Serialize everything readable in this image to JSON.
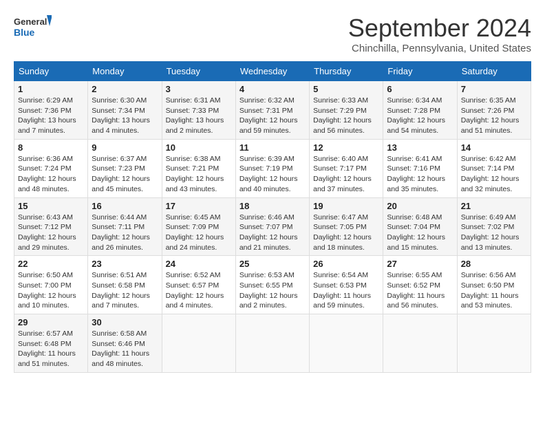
{
  "header": {
    "logo_line1": "General",
    "logo_line2": "Blue",
    "month": "September 2024",
    "location": "Chinchilla, Pennsylvania, United States"
  },
  "weekdays": [
    "Sunday",
    "Monday",
    "Tuesday",
    "Wednesday",
    "Thursday",
    "Friday",
    "Saturday"
  ],
  "weeks": [
    [
      {
        "day": "1",
        "info": "Sunrise: 6:29 AM\nSunset: 7:36 PM\nDaylight: 13 hours\nand 7 minutes."
      },
      {
        "day": "2",
        "info": "Sunrise: 6:30 AM\nSunset: 7:34 PM\nDaylight: 13 hours\nand 4 minutes."
      },
      {
        "day": "3",
        "info": "Sunrise: 6:31 AM\nSunset: 7:33 PM\nDaylight: 13 hours\nand 2 minutes."
      },
      {
        "day": "4",
        "info": "Sunrise: 6:32 AM\nSunset: 7:31 PM\nDaylight: 12 hours\nand 59 minutes."
      },
      {
        "day": "5",
        "info": "Sunrise: 6:33 AM\nSunset: 7:29 PM\nDaylight: 12 hours\nand 56 minutes."
      },
      {
        "day": "6",
        "info": "Sunrise: 6:34 AM\nSunset: 7:28 PM\nDaylight: 12 hours\nand 54 minutes."
      },
      {
        "day": "7",
        "info": "Sunrise: 6:35 AM\nSunset: 7:26 PM\nDaylight: 12 hours\nand 51 minutes."
      }
    ],
    [
      {
        "day": "8",
        "info": "Sunrise: 6:36 AM\nSunset: 7:24 PM\nDaylight: 12 hours\nand 48 minutes."
      },
      {
        "day": "9",
        "info": "Sunrise: 6:37 AM\nSunset: 7:23 PM\nDaylight: 12 hours\nand 45 minutes."
      },
      {
        "day": "10",
        "info": "Sunrise: 6:38 AM\nSunset: 7:21 PM\nDaylight: 12 hours\nand 43 minutes."
      },
      {
        "day": "11",
        "info": "Sunrise: 6:39 AM\nSunset: 7:19 PM\nDaylight: 12 hours\nand 40 minutes."
      },
      {
        "day": "12",
        "info": "Sunrise: 6:40 AM\nSunset: 7:17 PM\nDaylight: 12 hours\nand 37 minutes."
      },
      {
        "day": "13",
        "info": "Sunrise: 6:41 AM\nSunset: 7:16 PM\nDaylight: 12 hours\nand 35 minutes."
      },
      {
        "day": "14",
        "info": "Sunrise: 6:42 AM\nSunset: 7:14 PM\nDaylight: 12 hours\nand 32 minutes."
      }
    ],
    [
      {
        "day": "15",
        "info": "Sunrise: 6:43 AM\nSunset: 7:12 PM\nDaylight: 12 hours\nand 29 minutes."
      },
      {
        "day": "16",
        "info": "Sunrise: 6:44 AM\nSunset: 7:11 PM\nDaylight: 12 hours\nand 26 minutes."
      },
      {
        "day": "17",
        "info": "Sunrise: 6:45 AM\nSunset: 7:09 PM\nDaylight: 12 hours\nand 24 minutes."
      },
      {
        "day": "18",
        "info": "Sunrise: 6:46 AM\nSunset: 7:07 PM\nDaylight: 12 hours\nand 21 minutes."
      },
      {
        "day": "19",
        "info": "Sunrise: 6:47 AM\nSunset: 7:05 PM\nDaylight: 12 hours\nand 18 minutes."
      },
      {
        "day": "20",
        "info": "Sunrise: 6:48 AM\nSunset: 7:04 PM\nDaylight: 12 hours\nand 15 minutes."
      },
      {
        "day": "21",
        "info": "Sunrise: 6:49 AM\nSunset: 7:02 PM\nDaylight: 12 hours\nand 13 minutes."
      }
    ],
    [
      {
        "day": "22",
        "info": "Sunrise: 6:50 AM\nSunset: 7:00 PM\nDaylight: 12 hours\nand 10 minutes."
      },
      {
        "day": "23",
        "info": "Sunrise: 6:51 AM\nSunset: 6:58 PM\nDaylight: 12 hours\nand 7 minutes."
      },
      {
        "day": "24",
        "info": "Sunrise: 6:52 AM\nSunset: 6:57 PM\nDaylight: 12 hours\nand 4 minutes."
      },
      {
        "day": "25",
        "info": "Sunrise: 6:53 AM\nSunset: 6:55 PM\nDaylight: 12 hours\nand 2 minutes."
      },
      {
        "day": "26",
        "info": "Sunrise: 6:54 AM\nSunset: 6:53 PM\nDaylight: 11 hours\nand 59 minutes."
      },
      {
        "day": "27",
        "info": "Sunrise: 6:55 AM\nSunset: 6:52 PM\nDaylight: 11 hours\nand 56 minutes."
      },
      {
        "day": "28",
        "info": "Sunrise: 6:56 AM\nSunset: 6:50 PM\nDaylight: 11 hours\nand 53 minutes."
      }
    ],
    [
      {
        "day": "29",
        "info": "Sunrise: 6:57 AM\nSunset: 6:48 PM\nDaylight: 11 hours\nand 51 minutes."
      },
      {
        "day": "30",
        "info": "Sunrise: 6:58 AM\nSunset: 6:46 PM\nDaylight: 11 hours\nand 48 minutes."
      },
      {
        "day": "",
        "info": ""
      },
      {
        "day": "",
        "info": ""
      },
      {
        "day": "",
        "info": ""
      },
      {
        "day": "",
        "info": ""
      },
      {
        "day": "",
        "info": ""
      }
    ]
  ]
}
